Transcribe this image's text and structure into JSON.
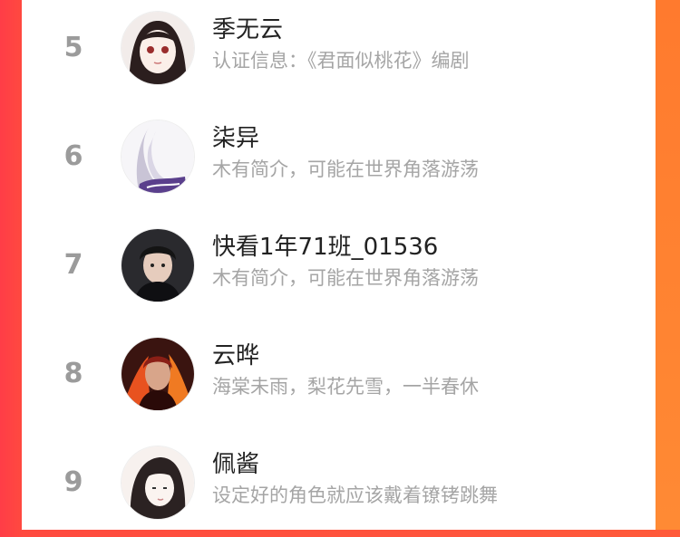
{
  "colors": {
    "accent_left": "#ff3d47",
    "accent_right": "#ff7a2e",
    "rank_text": "#9b9b9b",
    "name_text": "#222222",
    "desc_text": "#a5a5a5"
  },
  "ranking": {
    "rows": [
      {
        "rank": "5",
        "name": "季无云",
        "desc": "认证信息：《君面似桃花》编剧",
        "avatar_icon": "anime-girl-avatar"
      },
      {
        "rank": "6",
        "name": "柒异",
        "desc": "木有简介，可能在世界角落游荡",
        "avatar_icon": "silver-hair-avatar"
      },
      {
        "rank": "7",
        "name": "快看1年71班_01536",
        "desc": "木有简介，可能在世界角落游荡",
        "avatar_icon": "dark-hair-boy-avatar"
      },
      {
        "rank": "8",
        "name": "云晔",
        "desc": "海棠未雨，梨花先雪，一半春休",
        "avatar_icon": "fire-character-avatar"
      },
      {
        "rank": "9",
        "name": "佩酱",
        "desc": "设定好的角色就应该戴着镣铐跳舞",
        "avatar_icon": "sketch-girl-avatar"
      }
    ]
  }
}
